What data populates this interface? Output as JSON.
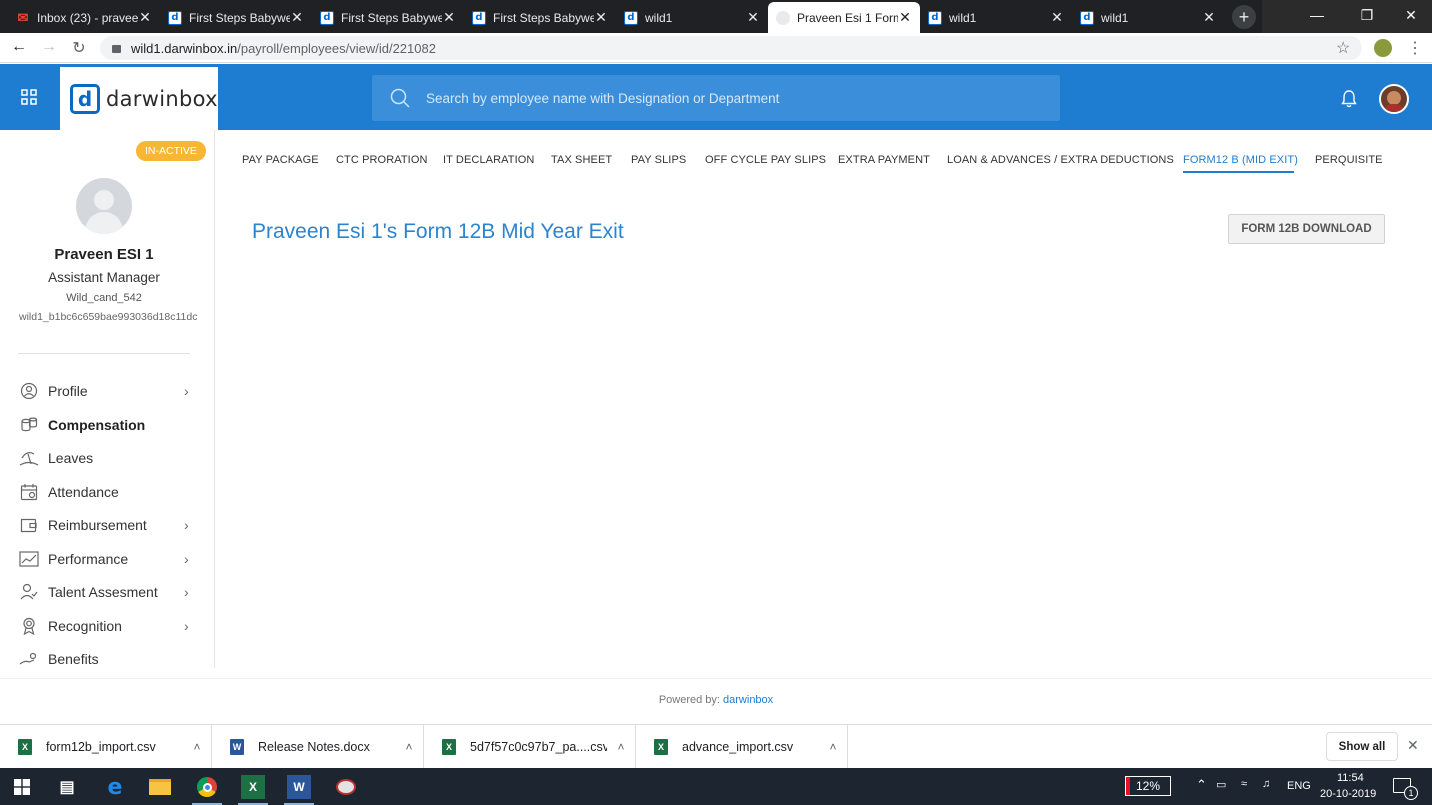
{
  "browser": {
    "tabs": [
      {
        "title": "Inbox (23) - praveen",
        "icon": "gmail-icon"
      },
      {
        "title": "First Steps Babywe",
        "icon": "darwinbox-favicon"
      },
      {
        "title": "First Steps Babywe",
        "icon": "darwinbox-favicon"
      },
      {
        "title": "First Steps Babywe",
        "icon": "darwinbox-favicon"
      },
      {
        "title": "wild1",
        "icon": "darwinbox-favicon"
      },
      {
        "title": "Praveen Esi 1 Form",
        "icon": "globe-icon",
        "active": true
      },
      {
        "title": "wild1",
        "icon": "darwinbox-favicon"
      },
      {
        "title": "wild1",
        "icon": "darwinbox-favicon"
      }
    ],
    "url_host": "wild1.darwinbox.in",
    "url_path": "/payroll/employees/view/id/221082"
  },
  "app": {
    "logo_text": "darwinbox",
    "logo_mark": "d",
    "search_placeholder": "Search by employee name with Designation or Department"
  },
  "employee": {
    "status": "IN-ACTIVE",
    "name": "Praveen ESI 1",
    "designation": "Assistant Manager",
    "code": "Wild_cand_542",
    "id": "wild1_b1bc6c659bae993036d18c11dc"
  },
  "sidebar": {
    "items": [
      {
        "label": "Profile",
        "icon": "profile-icon",
        "chevron": true
      },
      {
        "label": "Compensation",
        "icon": "coins-icon",
        "chevron": false,
        "active": true
      },
      {
        "label": "Leaves",
        "icon": "beach-icon",
        "chevron": false
      },
      {
        "label": "Attendance",
        "icon": "calendar-icon",
        "chevron": false
      },
      {
        "label": "Reimbursement",
        "icon": "wallet-icon",
        "chevron": true
      },
      {
        "label": "Performance",
        "icon": "chart-icon",
        "chevron": true
      },
      {
        "label": "Talent Assesment",
        "icon": "person-icon",
        "chevron": true
      },
      {
        "label": "Recognition",
        "icon": "badge-icon",
        "chevron": true
      },
      {
        "label": "Benefits",
        "icon": "benefits-icon",
        "chevron": false
      }
    ]
  },
  "tabs": [
    {
      "label": "PAY PACKAGE"
    },
    {
      "label": "CTC PRORATION"
    },
    {
      "label": "IT DECLARATION"
    },
    {
      "label": "TAX SHEET"
    },
    {
      "label": "PAY SLIPS"
    },
    {
      "label": "OFF CYCLE PAY SLIPS"
    },
    {
      "label": "EXTRA PAYMENT"
    },
    {
      "label": "LOAN & ADVANCES / EXTRA DEDUCTIONS"
    },
    {
      "label": "FORM12 B (MID EXIT)",
      "active": true
    },
    {
      "label": "PERQUISITE"
    }
  ],
  "main": {
    "heading": "Praveen Esi 1's Form 12B Mid Year Exit",
    "download_label": "FORM 12B DOWNLOAD"
  },
  "footer": {
    "powered_prefix": "Powered by:",
    "powered_brand": "darwinbox"
  },
  "downloads": {
    "items": [
      {
        "name": "form12b_import.csv",
        "type": "excel"
      },
      {
        "name": "Release Notes.docx",
        "type": "word"
      },
      {
        "name": "5d7f57c0c97b7_pa....csv",
        "type": "excel"
      },
      {
        "name": "advance_import.csv",
        "type": "excel"
      }
    ],
    "show_all": "Show all"
  },
  "taskbar": {
    "battery": "12%",
    "language": "ENG",
    "time": "11:54",
    "date": "20-10-2019",
    "notification_count": "1"
  },
  "colors": {
    "brand_blue": "#1f7dd1",
    "status_orange": "#f8b634"
  }
}
